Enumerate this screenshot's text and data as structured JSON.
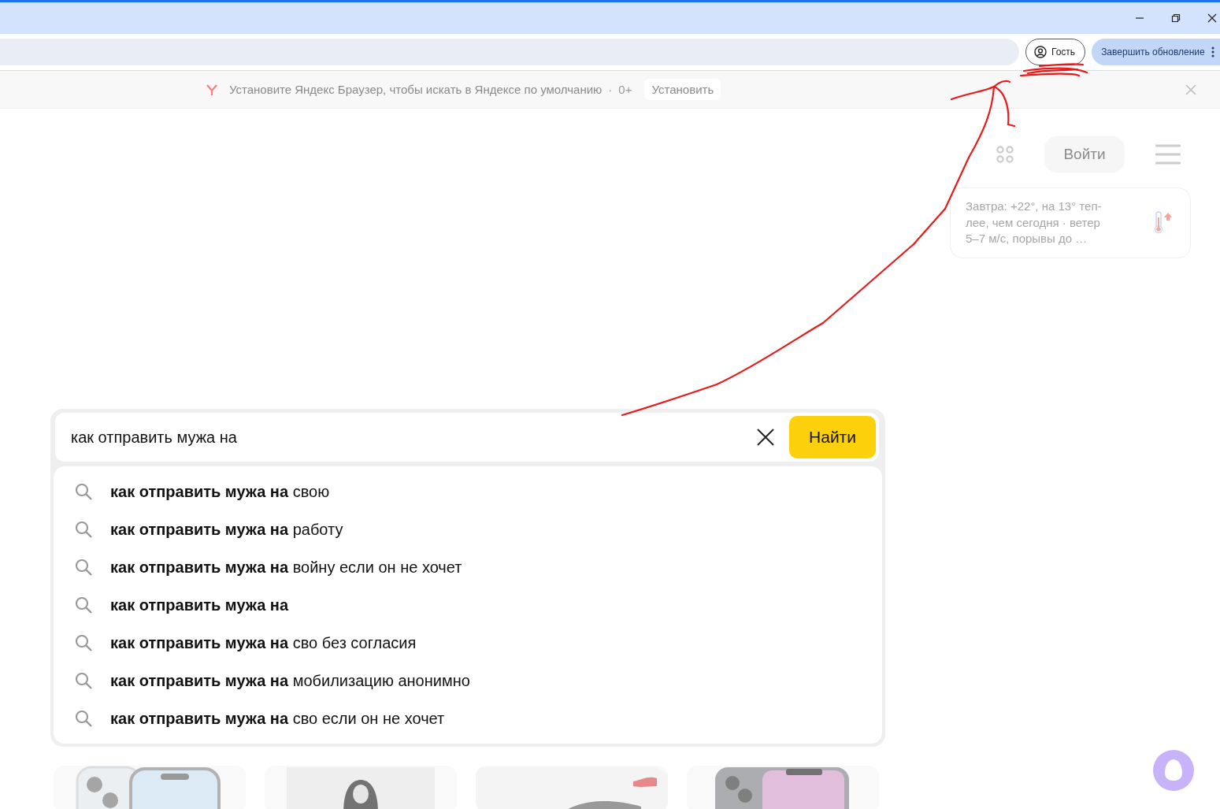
{
  "browser": {
    "guest_label": "Гость",
    "update_button": "Завершить обновление"
  },
  "infobar": {
    "message": "Установите Яндекс Браузер, чтобы искать в Яндексе по умолчанию",
    "separator": "·",
    "age": "0+",
    "install_button": "Установить"
  },
  "header": {
    "login_button": "Войти"
  },
  "weather": {
    "lines": [
      "Завтра: +22°, на 13° теп-",
      "лее, чем сегодня · ветер",
      "5–7 м/с, порывы до …"
    ]
  },
  "search": {
    "value": "как отправить мужа на ",
    "submit_button": "Найти"
  },
  "suggestions": [
    {
      "query": "как отправить мужа на",
      "rest": "свою"
    },
    {
      "query": "как отправить мужа на",
      "rest": "работу"
    },
    {
      "query": "как отправить мужа на",
      "rest": "войну если он не хочет"
    },
    {
      "query": "как отправить мужа на"
    },
    {
      "query": "как отправить мужа на",
      "rest": "сво без согласия"
    },
    {
      "query": "как отправить мужа на",
      "rest": "мобилизацию анонимно"
    },
    {
      "query": "как отправить мужа на",
      "rest": "сво если он не хочет"
    }
  ]
}
